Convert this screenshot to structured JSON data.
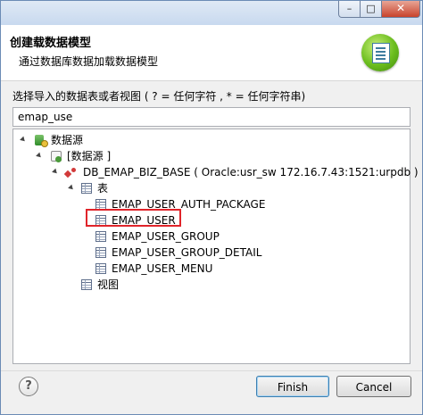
{
  "window": {
    "controls": {
      "minimize": "–",
      "maximize": "□",
      "close": "✕"
    }
  },
  "header": {
    "title": "创建载数据模型",
    "description": "通过数据库数据加载数据模型",
    "logo_icon": "wizard-document-icon"
  },
  "filter": {
    "label": "选择导入的数据表或者视图 ( ? = 任何字符 , * = 任何字符串)",
    "value": "emap_use"
  },
  "tree": {
    "root": {
      "label": "数据源",
      "icon": "datasource-icon"
    },
    "datasource": {
      "label": "[数据源 ]",
      "icon": "database-icon"
    },
    "connection": {
      "label": "DB_EMAP_BIZ_BASE ( Oracle:usr_sw 172.16.7.43:1521:urpdb )",
      "icon": "schema-icon"
    },
    "tables_folder": {
      "label": "表"
    },
    "tables": [
      {
        "label": "EMAP_USER_AUTH_PACKAGE",
        "highlighted": false
      },
      {
        "label": "EMAP_USER",
        "highlighted": true
      },
      {
        "label": "EMAP_USER_GROUP",
        "highlighted": false
      },
      {
        "label": "EMAP_USER_GROUP_DETAIL",
        "highlighted": false
      },
      {
        "label": "EMAP_USER_MENU",
        "highlighted": false
      }
    ],
    "views_folder": {
      "label": "视图"
    },
    "highlight_color": "#e0242a"
  },
  "footer": {
    "help": "?",
    "finish_label": "Finish",
    "cancel_label": "Cancel"
  }
}
